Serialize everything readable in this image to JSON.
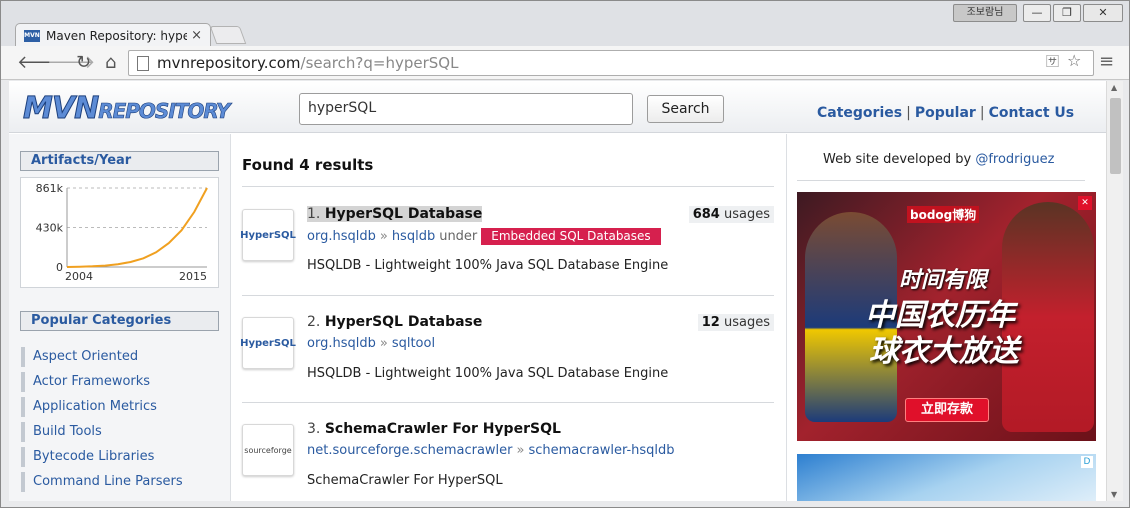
{
  "browser": {
    "tab_title": "Maven Repository: hyperS",
    "tab_favicon": "MVN",
    "tab_close": "×",
    "ime_label": "조보람님",
    "url_host": "mvnrepository.com",
    "url_path": "/search?q=hyperSQL"
  },
  "header": {
    "logo_big": "MVN",
    "logo_small": "REPOSITORY",
    "search_value": "hyperSQL",
    "search_button": "Search",
    "nav": [
      "Categories",
      "Popular",
      "Contact Us"
    ],
    "nav_sep": "|"
  },
  "sidebar": {
    "artifacts_title": "Artifacts/Year",
    "popular_title": "Popular Categories",
    "categories": [
      "Aspect Oriented",
      "Actor Frameworks",
      "Application Metrics",
      "Build Tools",
      "Bytecode Libraries",
      "Command Line Parsers"
    ]
  },
  "chart_data": {
    "type": "line",
    "x": [
      2004,
      2005,
      2006,
      2007,
      2008,
      2009,
      2010,
      2011,
      2012,
      2013,
      2014,
      2015
    ],
    "values": [
      0,
      3000,
      8000,
      15000,
      30000,
      55000,
      95000,
      160000,
      260000,
      400000,
      600000,
      861000
    ],
    "y_ticks": [
      "861k",
      "430k",
      "0"
    ],
    "x_ticks": [
      "2004",
      "2015"
    ],
    "ylim": [
      0,
      861000
    ],
    "line_color": "#f0a020",
    "grid": true
  },
  "main": {
    "found_text": "Found 4 results",
    "results": [
      {
        "num": "1.",
        "name": "HyperSQL Database",
        "image_text": "HyperSQL",
        "usage_count": "684",
        "usage_word": "usages",
        "group": "org.hsqldb",
        "artifact": "hsqldb",
        "under": "under",
        "category": "Embedded SQL Databases",
        "description": "HSQLDB - Lightweight 100% Java SQL Database Engine"
      },
      {
        "num": "2.",
        "name": "HyperSQL Database",
        "image_text": "HyperSQL",
        "usage_count": "12",
        "usage_word": "usages",
        "group": "org.hsqldb",
        "artifact": "sqltool",
        "description": "HSQLDB - Lightweight 100% Java SQL Database Engine"
      },
      {
        "num": "3.",
        "name": "SchemaCrawler For HyperSQL",
        "image_text": "sourceforge",
        "group": "net.sourceforge.schemacrawler",
        "artifact": "schemacrawler-hsqldb",
        "description": "SchemaCrawler For HyperSQL"
      }
    ],
    "arrow": "»"
  },
  "right": {
    "dev_text": "Web site developed by ",
    "dev_link": "@frodriguez",
    "ad_brand": "bodog博狗",
    "ad_line1": "时间有限",
    "ad_line2": "中国农历年",
    "ad_line3": "球衣大放送",
    "ad_cta": "立即存款",
    "ad_choices": "D"
  },
  "colors": {
    "accent": "#2a5aa0",
    "badge": "#d6204e"
  }
}
